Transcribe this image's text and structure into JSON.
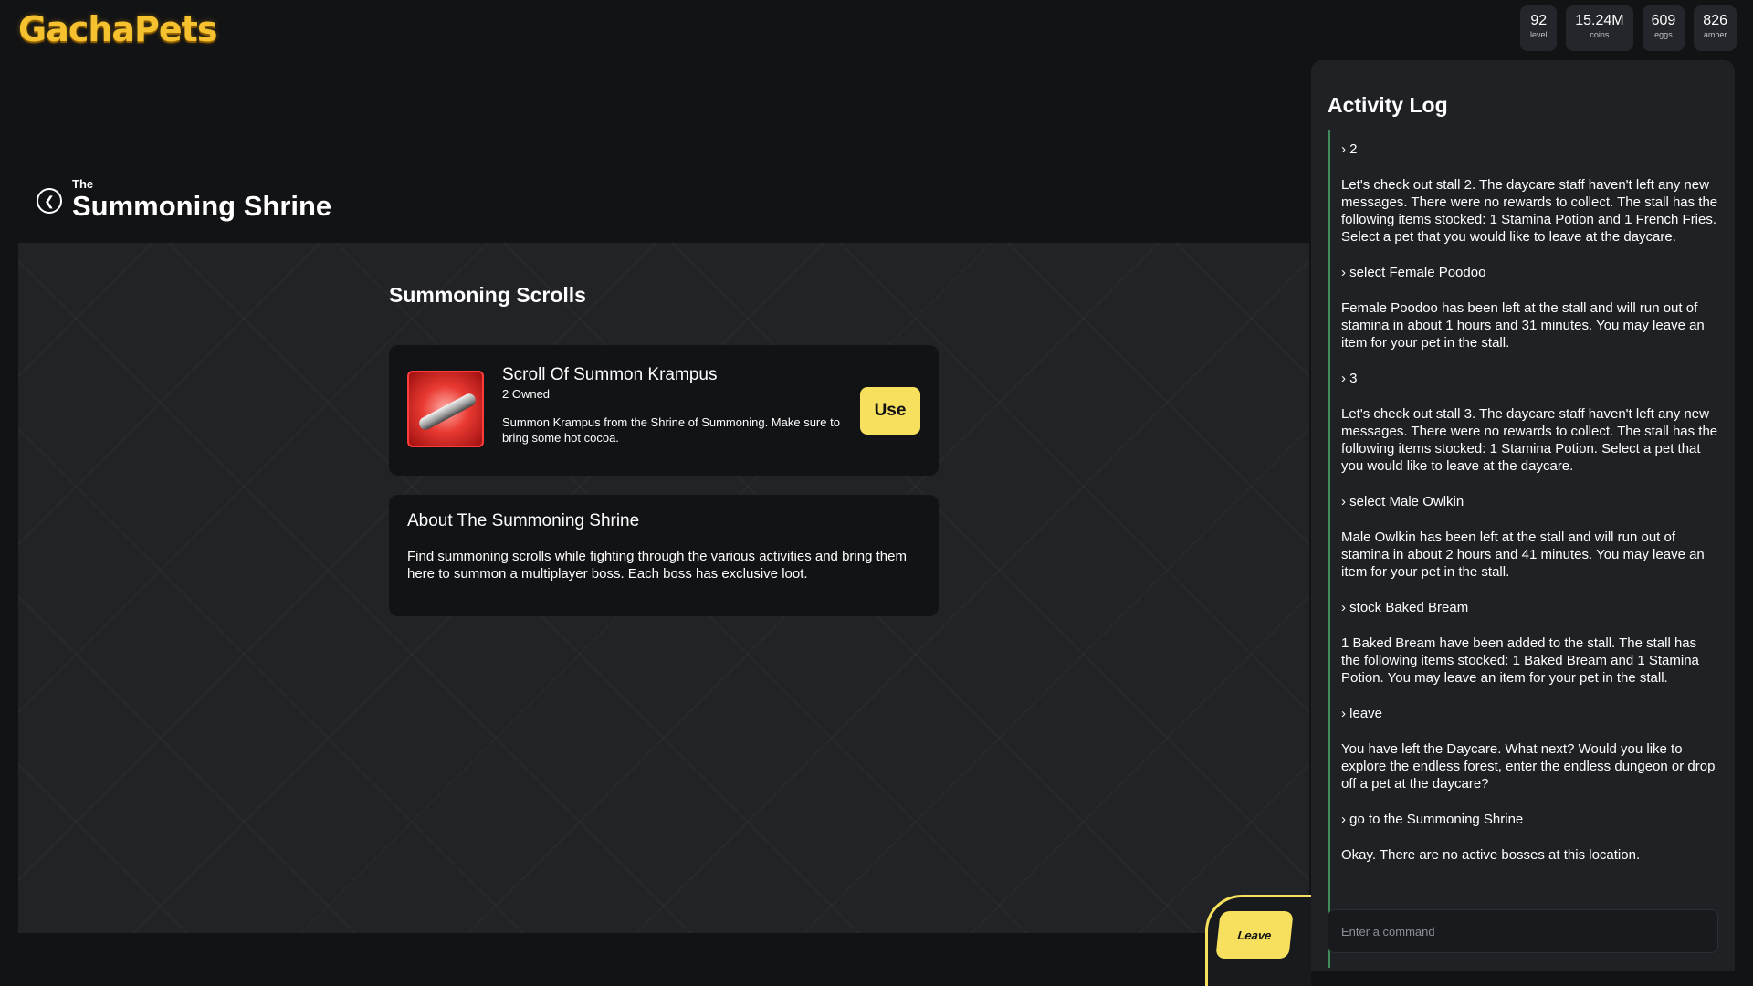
{
  "app": {
    "logo": "GachaPets"
  },
  "stats": [
    {
      "value": "92",
      "label": "level"
    },
    {
      "value": "15.24M",
      "label": "coins"
    },
    {
      "value": "609",
      "label": "eggs"
    },
    {
      "value": "826",
      "label": "amber"
    }
  ],
  "header": {
    "kicker": "The",
    "title": "Summoning Shrine"
  },
  "main": {
    "section_title": "Summoning Scrolls",
    "scroll": {
      "name": "Scroll Of Summon Krampus",
      "owned": "2 Owned",
      "description": "Summon Krampus from the Shrine of Summoning. Make sure to bring some hot cocoa.",
      "use_label": "Use"
    },
    "about": {
      "title": "About The Summoning Shrine",
      "text": "Find summoning scrolls while fighting through the various activities and bring them here to summon a multiplayer boss. Each boss has exclusive loot."
    }
  },
  "leave_label": "Leave",
  "log": {
    "title": "Activity Log",
    "entries": [
      {
        "type": "cmd",
        "text": "› 2"
      },
      {
        "type": "res",
        "text": "Let's check out stall 2. The daycare staff haven't left any new messages. There were no rewards to collect. The stall has the following items stocked: 1 Stamina Potion and 1 French Fries. Select a pet that you would like to leave at the daycare."
      },
      {
        "type": "cmd",
        "text": "› select Female Poodoo"
      },
      {
        "type": "res",
        "text": "Female Poodoo has been left at the stall and will run out of stamina in about 1 hours and 31 minutes. You may leave an item for your pet in the stall."
      },
      {
        "type": "cmd",
        "text": "› 3"
      },
      {
        "type": "res",
        "text": "Let's check out stall 3. The daycare staff haven't left any new messages. There were no rewards to collect. The stall has the following items stocked: 1 Stamina Potion. Select a pet that you would like to leave at the daycare."
      },
      {
        "type": "cmd",
        "text": "› select Male Owlkin"
      },
      {
        "type": "res",
        "text": "Male Owlkin has been left at the stall and will run out of stamina in about 2 hours and 41 minutes. You may leave an item for your pet in the stall."
      },
      {
        "type": "cmd",
        "text": "› stock Baked Bream"
      },
      {
        "type": "res",
        "text": "1 Baked Bream have been added to the stall. The stall has the following items stocked: 1 Baked Bream and 1 Stamina Potion. You may leave an item for your pet in the stall."
      },
      {
        "type": "cmd",
        "text": "› leave"
      },
      {
        "type": "res",
        "text": "You have left the Daycare. What next? Would you like to explore the endless forest, enter the endless dungeon or drop off a pet at the daycare?"
      },
      {
        "type": "cmd",
        "text": "› go to the Summoning Shrine"
      },
      {
        "type": "res",
        "text": "Okay. There are no active bosses at this location."
      }
    ],
    "input_placeholder": "Enter a command"
  }
}
